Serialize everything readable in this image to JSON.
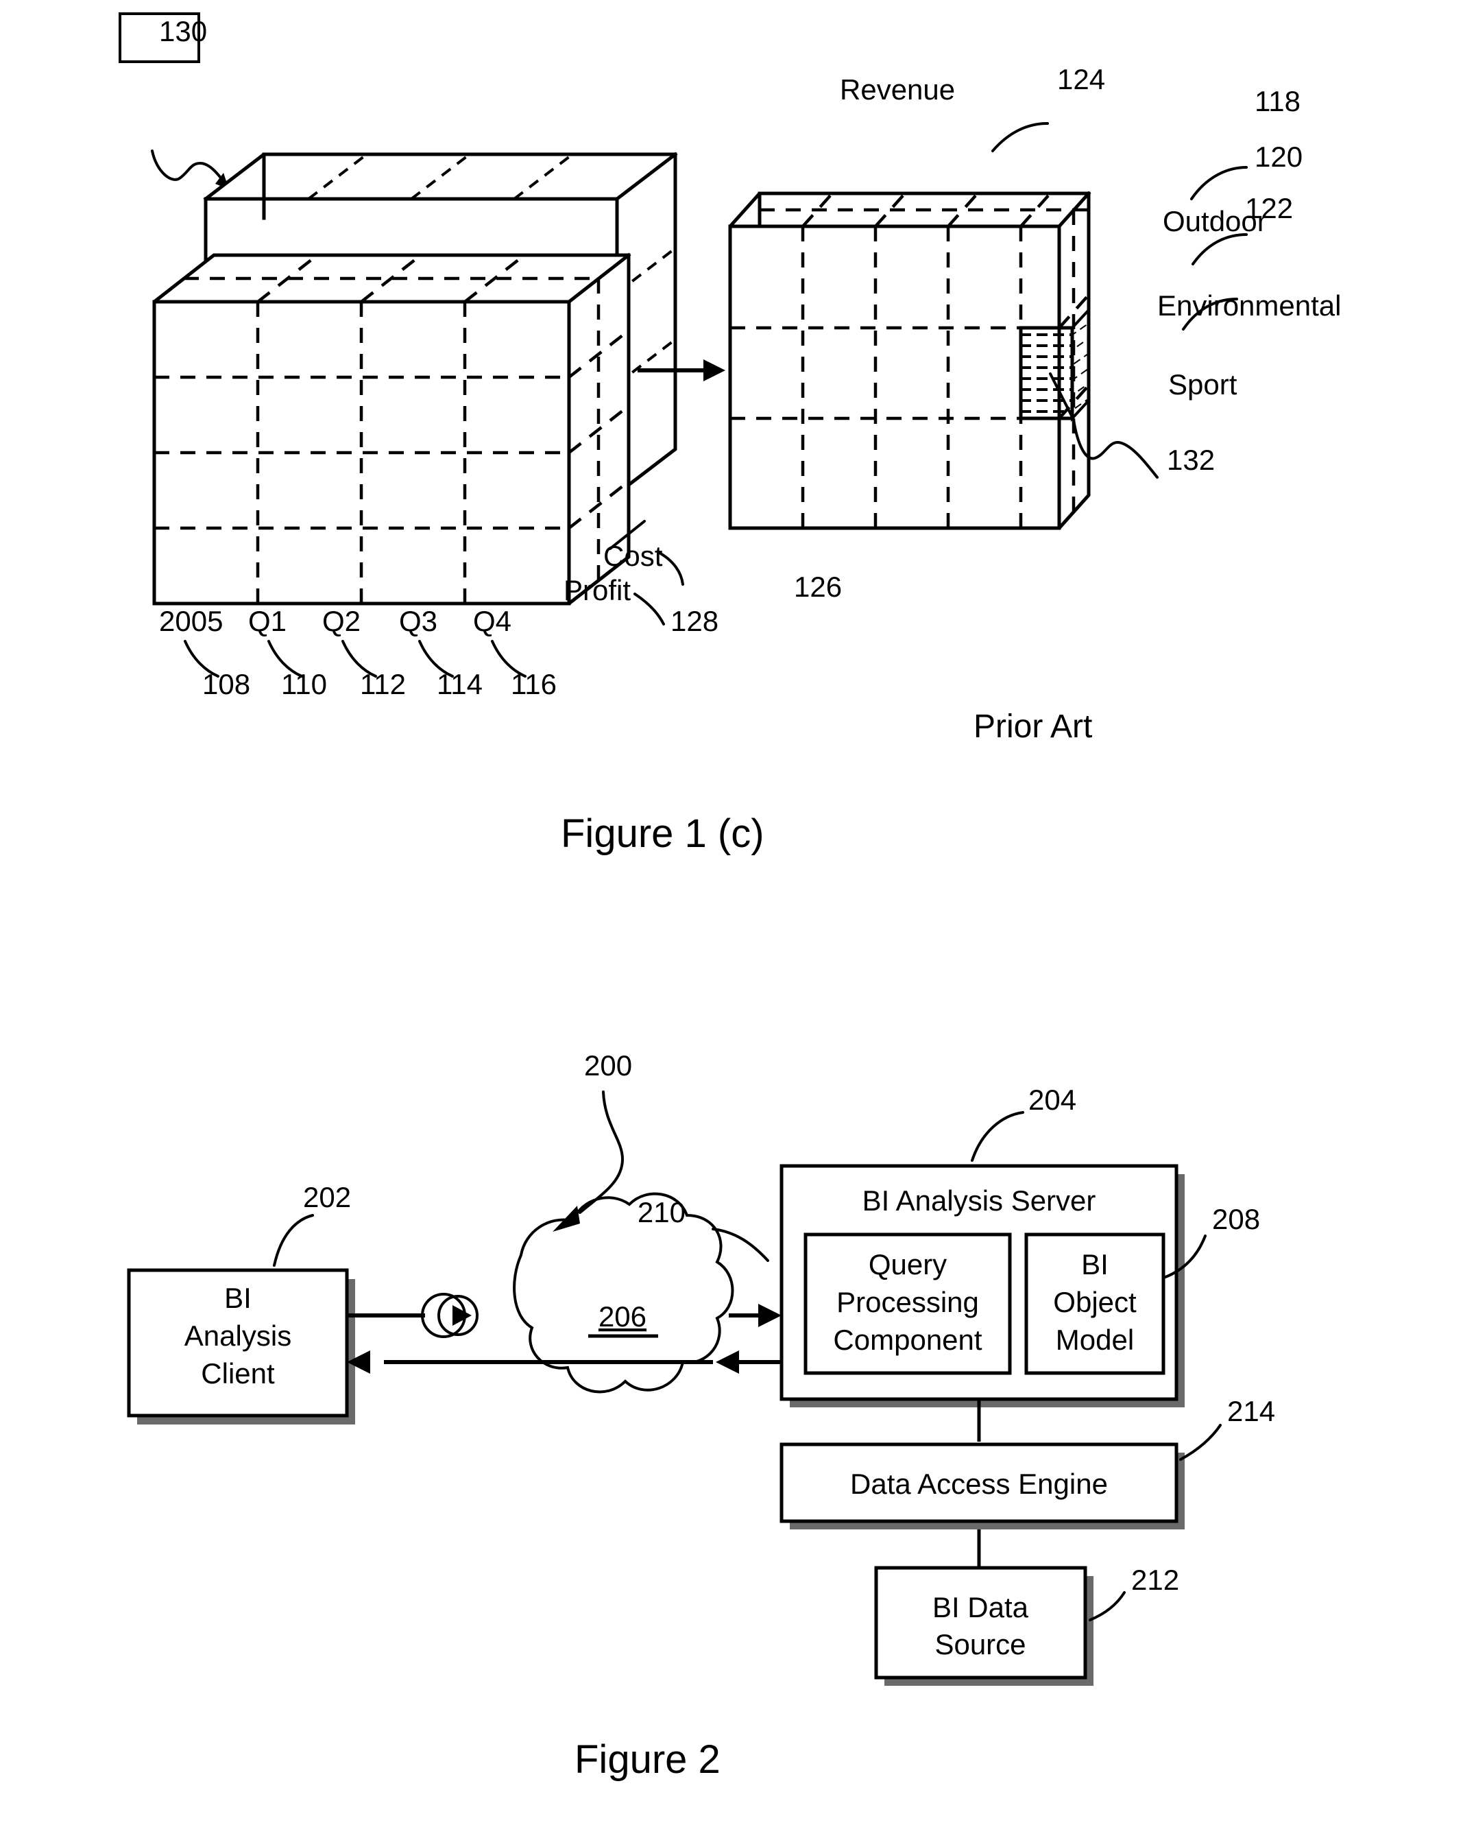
{
  "figure1": {
    "caption": "Figure 1 (c)",
    "prior_art_note": "Prior Art",
    "callout_box": "130",
    "labels": {
      "revenue": "Revenue",
      "cost": "Cost",
      "profit": "Profit",
      "outdoor": "Outdoor",
      "environmental": "Environmental",
      "sport": "Sport",
      "year": "2005",
      "q1": "Q1",
      "q2": "Q2",
      "q3": "Q3",
      "q4": "Q4"
    },
    "ref_numbers": {
      "source_cube": "130",
      "year": "108",
      "q1": "110",
      "q2": "112",
      "q3": "114",
      "q4": "116",
      "outdoor": "118",
      "environmental": "120",
      "sport": "122",
      "revenue": "124",
      "result_cube": "126",
      "measures": "128",
      "highlighted_cell": "132"
    }
  },
  "figure2": {
    "caption": "Figure 2",
    "system_ref": "200",
    "nodes": [
      {
        "id": "client",
        "label_lines": [
          "BI",
          "Analysis",
          "Client"
        ],
        "ref": "202"
      },
      {
        "id": "network",
        "label": "206",
        "ref": "206"
      },
      {
        "id": "server",
        "label": "BI Analysis Server",
        "ref": "204"
      },
      {
        "id": "query",
        "label_lines": [
          "Query",
          "Processing",
          "Component"
        ],
        "ref": "210"
      },
      {
        "id": "model",
        "label_lines": [
          "BI",
          "Object",
          "Model"
        ],
        "ref": "208"
      },
      {
        "id": "dae",
        "label": "Data Access Engine",
        "ref": "214"
      },
      {
        "id": "source",
        "label_lines": [
          "BI Data",
          "Source"
        ],
        "ref": "212"
      }
    ],
    "texts": {
      "client_l1": "BI",
      "client_l2": "Analysis",
      "client_l3": "Client",
      "network_num": "206",
      "server_title": "BI Analysis Server",
      "query_l1": "Query",
      "query_l2": "Processing",
      "query_l3": "Component",
      "model_l1": "BI",
      "model_l2": "Object",
      "model_l3": "Model",
      "dae_title": "Data Access Engine",
      "source_l1": "BI Data",
      "source_l2": "Source"
    },
    "ref_numbers": {
      "system": "200",
      "client": "202",
      "server": "204",
      "model": "208",
      "query": "210",
      "source": "212",
      "dae": "214"
    }
  },
  "colors": {
    "ink": "#000000",
    "paper": "#ffffff",
    "shadow": "#6a6a6a"
  }
}
